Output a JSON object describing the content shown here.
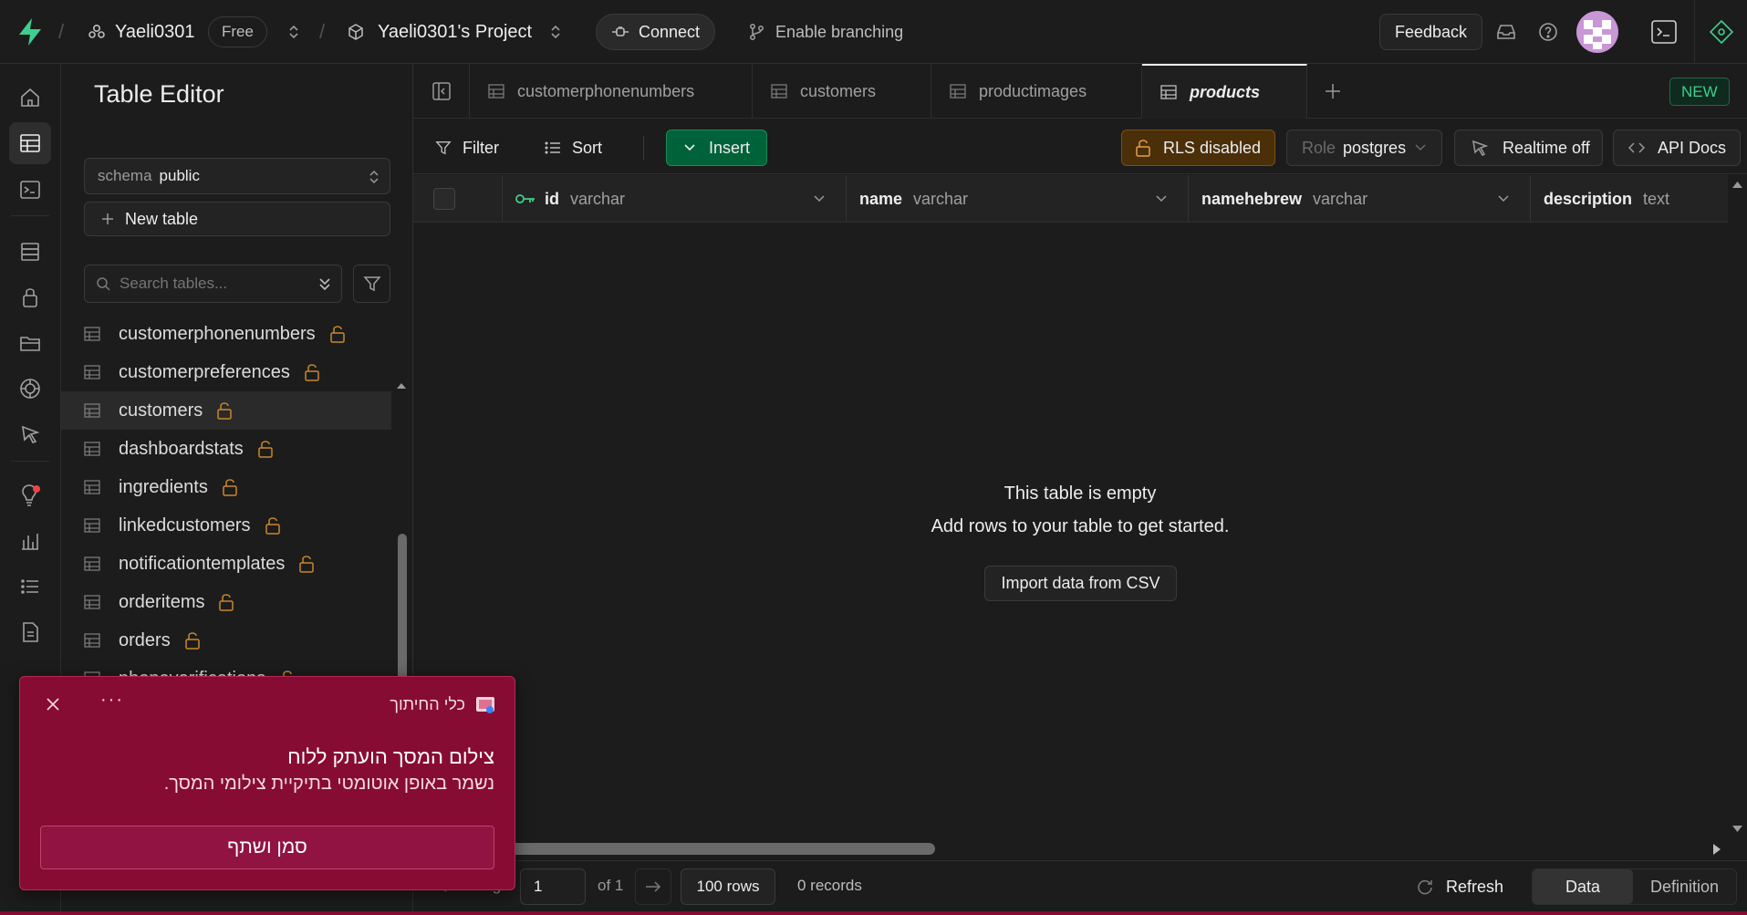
{
  "topbar": {
    "org_name": "Yaeli0301",
    "plan_badge": "Free",
    "project_name": "Yaeli0301's Project",
    "connect_label": "Connect",
    "branching_label": "Enable branching",
    "feedback_label": "Feedback"
  },
  "sidebar": {
    "title": "Table Editor",
    "schema_label": "schema",
    "schema_value": "public",
    "new_table_label": "New table",
    "search_placeholder": "Search tables...",
    "tables": [
      {
        "name": "customerphonenumbers"
      },
      {
        "name": "customerpreferences"
      },
      {
        "name": "customers"
      },
      {
        "name": "dashboardstats"
      },
      {
        "name": "ingredients"
      },
      {
        "name": "linkedcustomers"
      },
      {
        "name": "notificationtemplates"
      },
      {
        "name": "orderitems"
      },
      {
        "name": "orders"
      },
      {
        "name": "phoneverifications"
      }
    ]
  },
  "tabs": {
    "items": [
      {
        "label": "customerphonenumbers"
      },
      {
        "label": "customers"
      },
      {
        "label": "productimages"
      },
      {
        "label": "products"
      }
    ],
    "new_badge": "NEW"
  },
  "toolbar": {
    "filter_label": "Filter",
    "sort_label": "Sort",
    "insert_label": "Insert",
    "rls_label": "RLS disabled",
    "role_prefix": "Role",
    "role_value": "postgres",
    "realtime_label": "Realtime off",
    "api_docs_label": "API Docs"
  },
  "grid": {
    "columns": [
      {
        "name": "id",
        "type": "varchar"
      },
      {
        "name": "name",
        "type": "varchar"
      },
      {
        "name": "namehebrew",
        "type": "varchar"
      },
      {
        "name": "description",
        "type": "text"
      }
    ],
    "empty_title": "This table is empty",
    "empty_subtitle": "Add rows to your table to get started.",
    "import_label": "Import data from CSV"
  },
  "footer": {
    "page_label": "Page",
    "page_value": "1",
    "of_label": "of 1",
    "rows_label": "100 rows",
    "records_label": "0 records",
    "refresh_label": "Refresh",
    "data_tab": "Data",
    "definition_tab": "Definition"
  },
  "toast": {
    "app_name": "כלי החיתוך",
    "title": "צילום המסך הועתק ללוח",
    "body": "נשמר באופן אוטומטי בתיקיית צילומי המסך.",
    "action_label": "סמן ושתף",
    "more_label": "···"
  },
  "colors": {
    "accent_green": "#3ecf8e",
    "insert_bg": "#006239",
    "rls_bg": "#4a2f09",
    "lock_orange": "#c9882b",
    "toast_bg": "#870c34"
  }
}
